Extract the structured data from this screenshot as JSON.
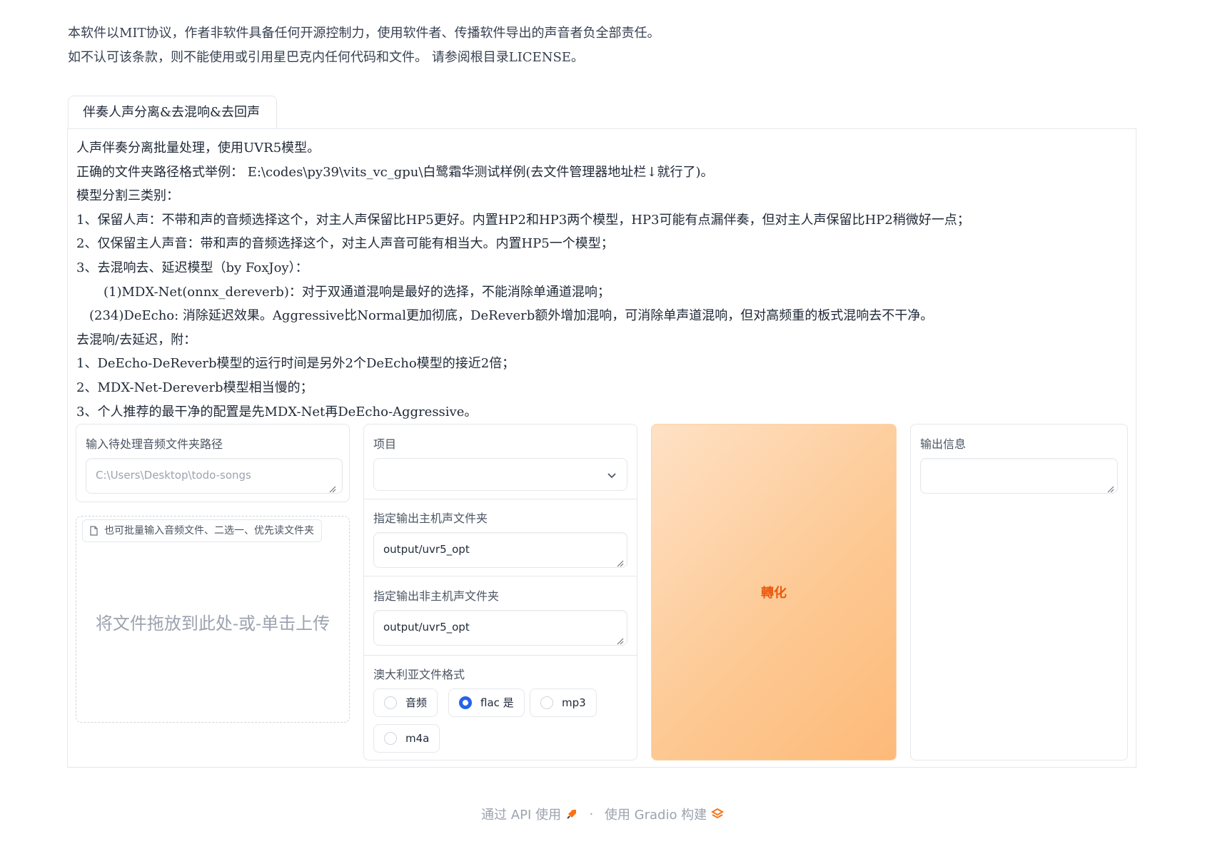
{
  "disclaimer": {
    "line1": "本软件以MIT协议，作者非软件具备任何开源控制力，使用软件者、传播软件导出的声音者负全部责任。",
    "line2": "如不认可该条款，则不能使用或引用星巴克内任何代码和文件。 请参阅根目录LICENSE。"
  },
  "tab": {
    "label": "伴奏人声分离&去混响&去回声"
  },
  "info": {
    "lines": [
      "人声伴奏分离批量处理，使用UVR5模型。",
      "正确的文件夹路径格式举例： E:\\codes\\py39\\vits_vc_gpu\\白鹭霜华测试样例(去文件管理器地址栏↓就行了)。",
      "模型分割三类别：",
      "1、保留人声：不带和声的音频选择这个，对主人声保留比HP5更好。内置HP2和HP3两个模型，HP3可能有点漏伴奏，但对主人声保留比HP2稍微好一点；",
      "2、仅保留主人声音：带和声的音频选择这个，对主人声音可能有相当大。内置HP5一个模型；",
      "3、去混响去、延迟模型（by FoxJoy）：",
      "(1)MDX-Net(onnx_dereverb)：对于双通道混响是最好的选择，不能消除单通道混响；",
      "(234)DeEcho: 消除延迟效果。Aggressive比Normal更加彻底，DeReverb额外增加混响，可消除单声道混响，但对高频重的板式混响去不干净。",
      "去混响/去延迟，附：",
      "1、DeEcho-DeReverb模型的运行时间是另外2个DeEcho模型的接近2倍；",
      "2、MDX-Net-Dereverb模型相当慢的；",
      "3、个人推荐的最干净的配置是先MDX-Net再DeEcho-Aggressive。"
    ]
  },
  "input_dir": {
    "label": "输入待处理音频文件夹路径",
    "placeholder": "C:\\Users\\Desktop\\todo-songs"
  },
  "upload": {
    "tag": "也可批量输入音频文件、二选一、优先读文件夹",
    "drop_text": "将文件拖放到此处-或-单击上传"
  },
  "model": {
    "label": "项目",
    "value": ""
  },
  "out_vocal": {
    "label": "指定输出主机声文件夹",
    "value": "output/uvr5_opt"
  },
  "out_inst": {
    "label": "指定输出非主机声文件夹",
    "value": "output/uvr5_opt"
  },
  "format": {
    "label": "澳大利亚文件格式",
    "options": [
      "音频",
      "flac 是",
      "mp3",
      "m4a"
    ],
    "selected": "flac 是"
  },
  "convert": {
    "label": "轉化"
  },
  "output": {
    "label": "输出信息",
    "value": ""
  },
  "footer": {
    "api": "通过 API 使用",
    "dot": "·",
    "built": "使用 Gradio 构建"
  },
  "colors": {
    "accent": "#ea580c",
    "radio_checked": "#2563eb",
    "border": "#e5e7eb"
  }
}
